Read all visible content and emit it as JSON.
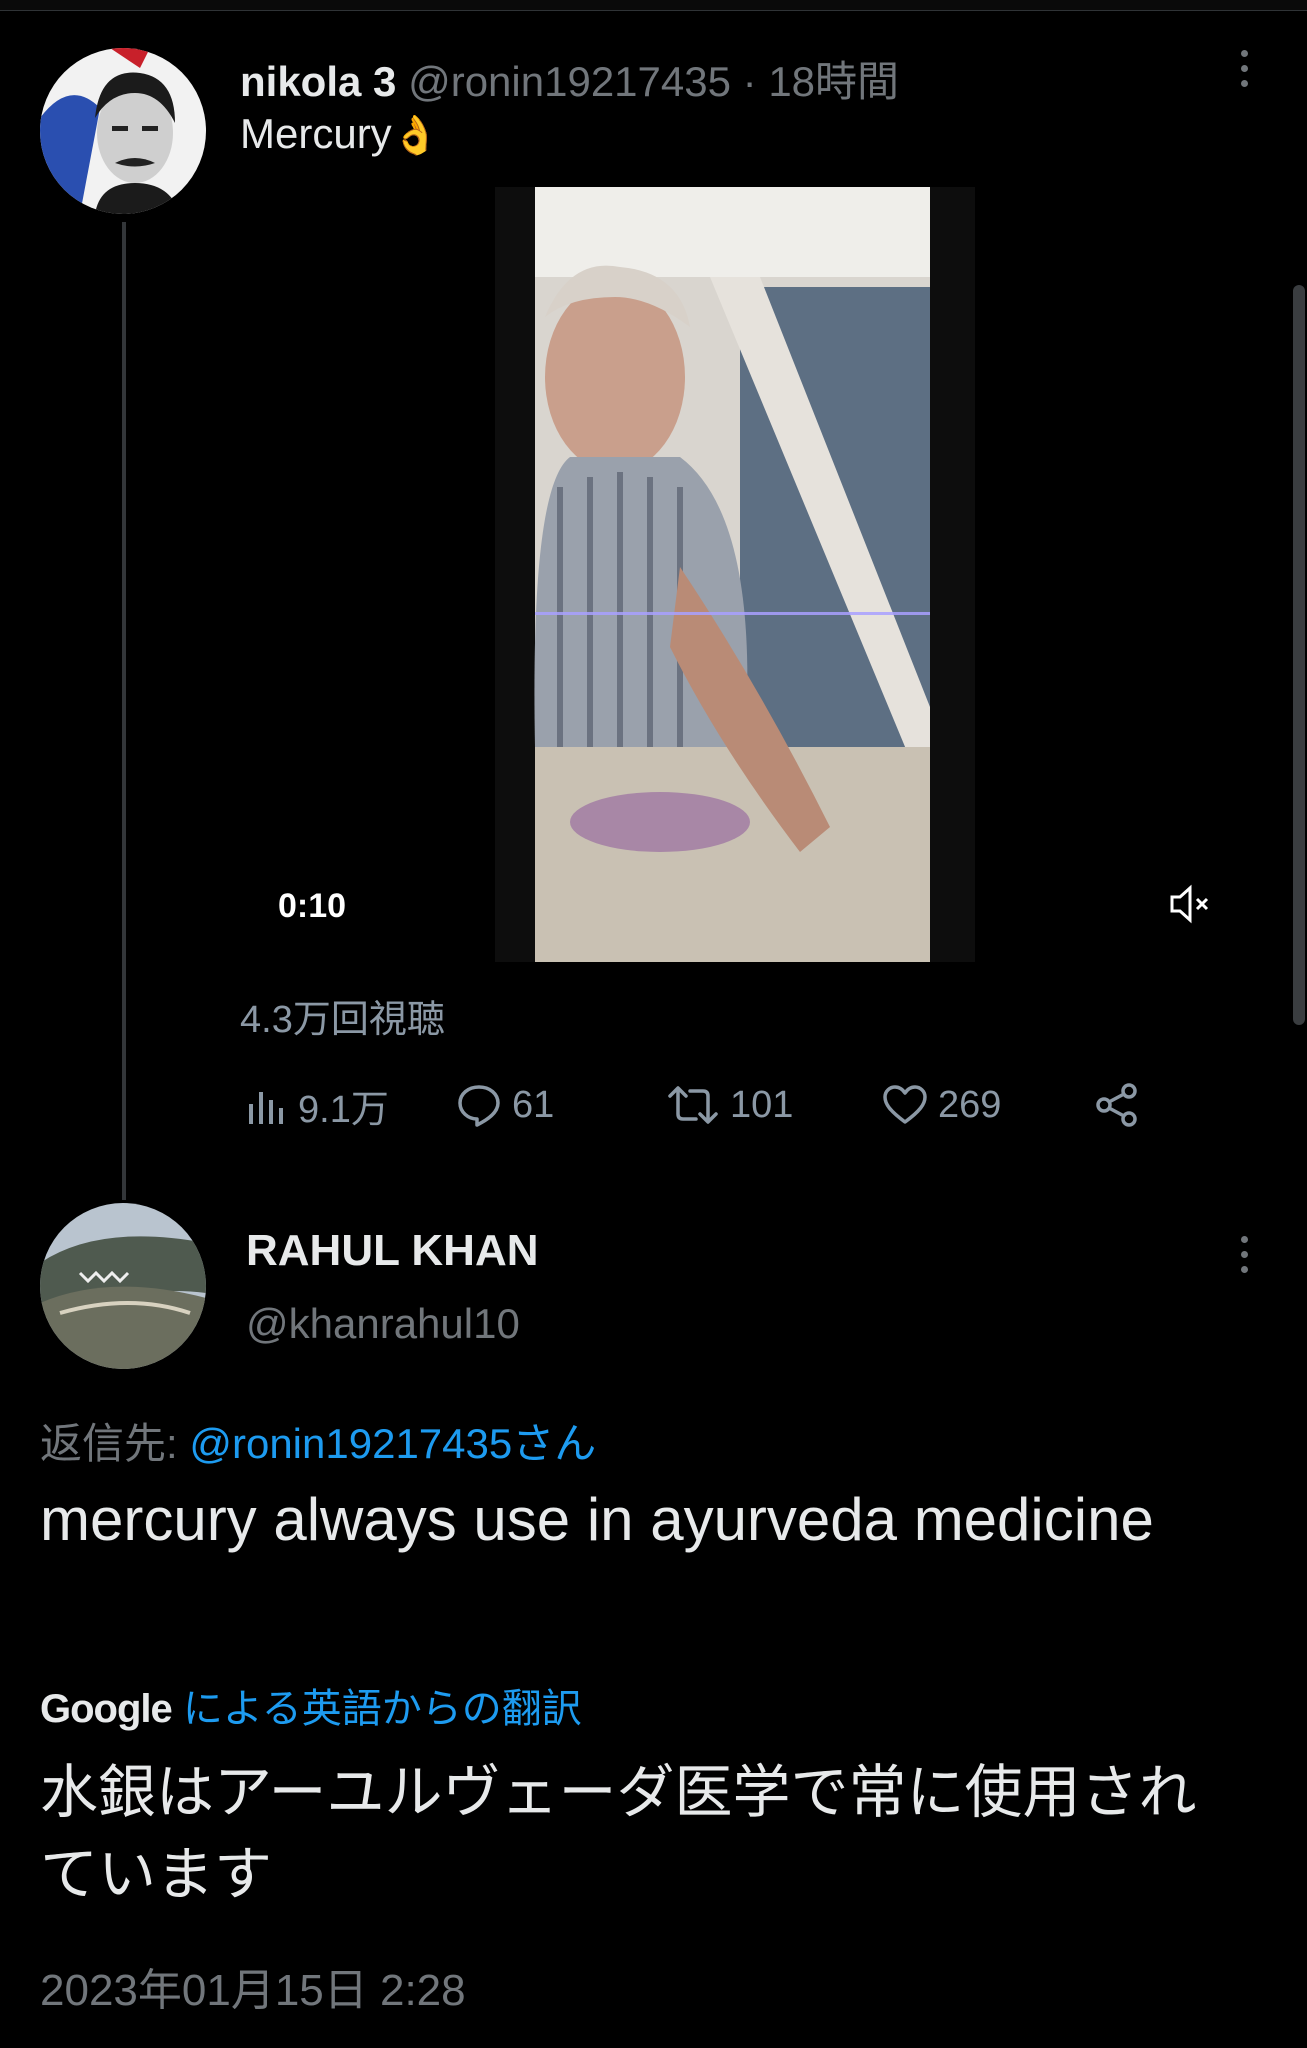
{
  "tweet": {
    "author_name": "nikola 3",
    "author_handle": "@ronin19217435",
    "separator": "·",
    "time": "18時間",
    "text": "Mercury",
    "emoji": "👌",
    "video": {
      "duration": "0:10",
      "muted": true
    },
    "views_text": "4.3万回視聴",
    "actions": {
      "views": "9.1万",
      "replies": "61",
      "retweets": "101",
      "likes": "269"
    }
  },
  "reply": {
    "author_name": "RAHUL KHAN",
    "author_handle": "@khanrahul10",
    "reply_prefix": "返信先:",
    "reply_to": "@ronin19217435さん",
    "text": "mercury always use in ayurveda medicine",
    "google_label": "Google",
    "translation_label": "による英語からの翻訳",
    "translation": "水銀はアーユルヴェーダ医学で常に使用されています",
    "timestamp": "2023年01月15日 2:28"
  },
  "colors": {
    "link": "#1d9bf0",
    "muted": "#71767b",
    "text": "#e7e9ea",
    "background": "#000000"
  }
}
